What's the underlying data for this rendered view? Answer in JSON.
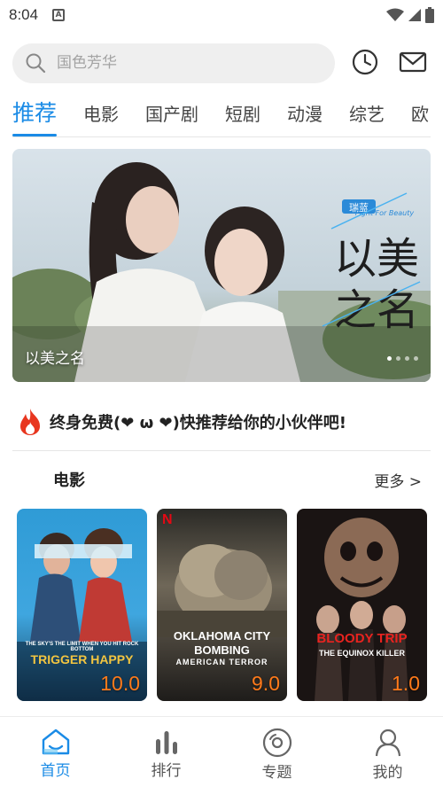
{
  "status_bar": {
    "time": "8:04",
    "notification_glyph": "A"
  },
  "search": {
    "placeholder": "国色芳华",
    "icon": "search-icon"
  },
  "header_actions": [
    {
      "icon": "history-clock-icon"
    },
    {
      "icon": "mail-icon"
    }
  ],
  "tabs": [
    {
      "label": "推荐",
      "active": true
    },
    {
      "label": "电影"
    },
    {
      "label": "国产剧"
    },
    {
      "label": "短剧"
    },
    {
      "label": "动漫"
    },
    {
      "label": "综艺"
    },
    {
      "label": "欧"
    }
  ],
  "banner": {
    "title": "以美之名",
    "poster_text": {
      "brand": "瑞蓝",
      "subtitle": "Fight For Beauty",
      "art_title_1": "以美",
      "art_title_2": "之名"
    },
    "total_slides": 4,
    "active_slide": 1
  },
  "promo": {
    "text": "终身免费(❤ ω ❤)快推荐给你的小伙伴吧!",
    "icon": "fire-icon"
  },
  "section": {
    "title": "电影",
    "more_label": "更多 >"
  },
  "movies": [
    {
      "poster_title": "TRIGGER HAPPY",
      "tagline": "THE SKY'S THE LIMIT WHEN YOU HIT ROCK BOTTOM",
      "score": "10.0"
    },
    {
      "poster_title": "OKLAHOMA CITY BOMBING",
      "subtitle": "AMERICAN TERROR",
      "badge": "N",
      "score": "9.0"
    },
    {
      "poster_title": "BLOODY TRIP",
      "subtitle": "THE EQUINOX KILLER",
      "score": "1.0"
    }
  ],
  "bottom_nav": [
    {
      "label": "首页",
      "icon": "home-icon",
      "active": true
    },
    {
      "label": "排行",
      "icon": "ranking-icon"
    },
    {
      "label": "专题",
      "icon": "topic-disc-icon"
    },
    {
      "label": "我的",
      "icon": "profile-icon"
    }
  ],
  "colors": {
    "accent": "#1a8be6",
    "score": "#ff7a1a",
    "fire": "#e8361f"
  }
}
